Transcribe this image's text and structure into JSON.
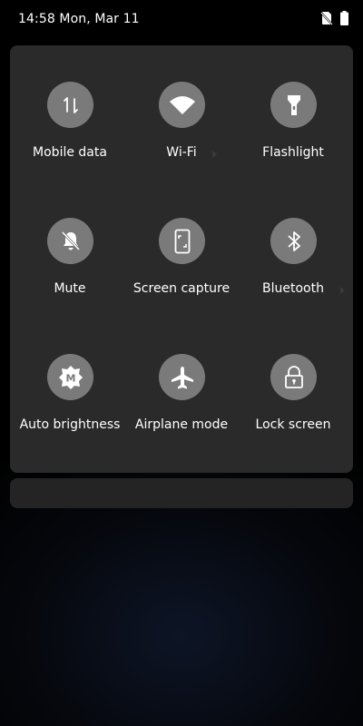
{
  "status_bar": {
    "time_date": "14:58 Mon, Mar 11",
    "icons": [
      "no-sim-icon",
      "battery-icon"
    ]
  },
  "quick_settings": {
    "tiles": [
      {
        "label": "Mobile data",
        "icon": "mobile-data-icon"
      },
      {
        "label": "Wi-Fi",
        "icon": "wifi-icon"
      },
      {
        "label": "Flashlight",
        "icon": "flashlight-icon"
      },
      {
        "label": "Mute",
        "icon": "mute-bell-icon"
      },
      {
        "label": "Screen capture",
        "icon": "screen-capture-icon"
      },
      {
        "label": "Bluetooth",
        "icon": "bluetooth-icon"
      },
      {
        "label": "Auto brightness",
        "icon": "auto-brightness-icon"
      },
      {
        "label": "Airplane mode",
        "icon": "airplane-icon"
      },
      {
        "label": "Lock screen",
        "icon": "lock-icon"
      }
    ],
    "auto_brightness_glyph": "M"
  },
  "colors": {
    "panel": "#2a2a2a",
    "tile_circle": "#7a7a7a",
    "icon": "#ffffff"
  }
}
